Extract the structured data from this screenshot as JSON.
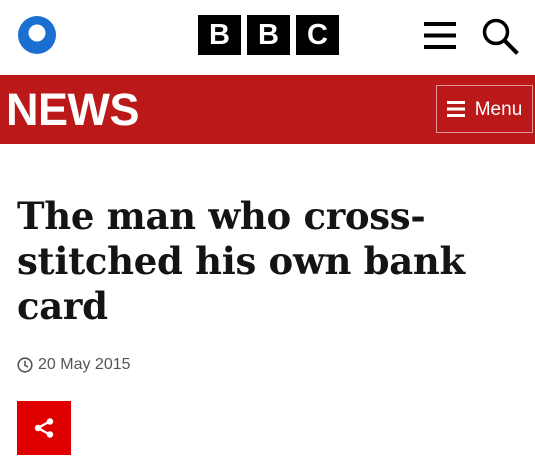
{
  "header": {
    "logo_letters": [
      "B",
      "B",
      "C"
    ],
    "icons": {
      "account": "account-icon",
      "menu": "hamburger-icon",
      "search": "search-icon"
    }
  },
  "news_bar": {
    "wordmark": "NEWS",
    "menu_label": "Menu",
    "menu_icon": "menu-icon",
    "background_color": "#bb1919"
  },
  "article": {
    "headline": "The man who cross-stitched his own bank card",
    "date": "20 May 2015",
    "date_icon": "clock-icon",
    "share_icon": "share-icon",
    "share_button_color": "#e00000"
  },
  "colors": {
    "account_icon": "#1a6fd0",
    "text": "#141414",
    "meta_text": "#545658"
  }
}
